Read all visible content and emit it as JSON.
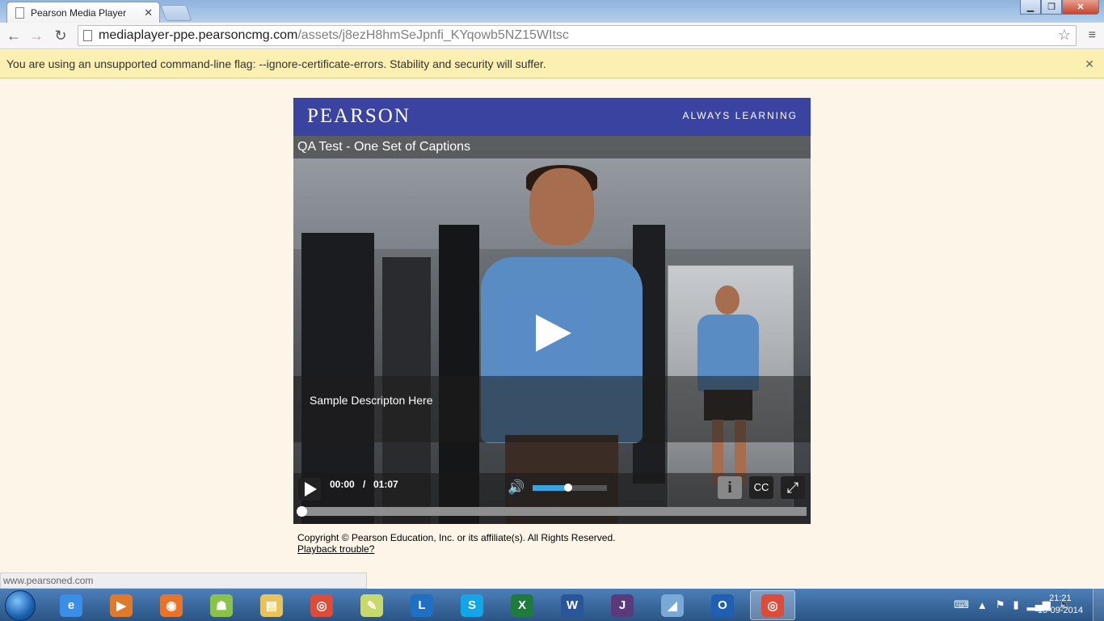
{
  "browser": {
    "tab_title": "Pearson Media Player",
    "url_host": "mediaplayer-ppe.pearsoncmg.com",
    "url_path": "/assets/j8ezH8hmSeJpnfi_KYqowb5NZ15WItsc",
    "infobar_message": "You are using an unsupported command-line flag: --ignore-certificate-errors. Stability and security will suffer.",
    "status_url": "www.pearsoned.com"
  },
  "player": {
    "brand": "PEARSON",
    "tagline": "ALWAYS LEARNING",
    "video_title": "QA Test - One Set of Captions",
    "description": "Sample Descripton Here",
    "current_time": "00:00",
    "time_separator": "/",
    "duration": "01:07",
    "volume_level": 0.48,
    "progress_fraction": 0,
    "info_label": "i",
    "cc_label": "CC"
  },
  "footer": {
    "copyright": "Copyright © Pearson Education, Inc. or its affiliate(s). All Rights Reserved.",
    "playback_link": "Playback trouble?"
  },
  "taskbar": {
    "apps": [
      {
        "name": "internet-explorer",
        "color": "#3a8ee6",
        "glyph": "e"
      },
      {
        "name": "media-player",
        "color": "#e07a2a",
        "glyph": "▶"
      },
      {
        "name": "firefox",
        "color": "#e8742a",
        "glyph": "◉"
      },
      {
        "name": "android",
        "color": "#8bc34a",
        "glyph": "☗"
      },
      {
        "name": "file-explorer",
        "color": "#e8c25a",
        "glyph": "▤"
      },
      {
        "name": "chrome",
        "color": "#dd4b39",
        "glyph": "◎"
      },
      {
        "name": "notes",
        "color": "#c9d86a",
        "glyph": "✎"
      },
      {
        "name": "lync",
        "color": "#1f6fc2",
        "glyph": "L"
      },
      {
        "name": "skype",
        "color": "#12a5e8",
        "glyph": "S"
      },
      {
        "name": "excel",
        "color": "#1f7a3e",
        "glyph": "X"
      },
      {
        "name": "word",
        "color": "#2a5699",
        "glyph": "W"
      },
      {
        "name": "java-ee-ide",
        "color": "#5a3a7a",
        "glyph": "J"
      },
      {
        "name": "pen-tool",
        "color": "#7aa9d6",
        "glyph": "◢"
      },
      {
        "name": "outlook",
        "color": "#1f5fb4",
        "glyph": "O"
      },
      {
        "name": "chrome-active",
        "color": "#dd4b39",
        "glyph": "◎"
      }
    ],
    "clock_time": "21:21",
    "clock_date": "16-09-2014"
  }
}
